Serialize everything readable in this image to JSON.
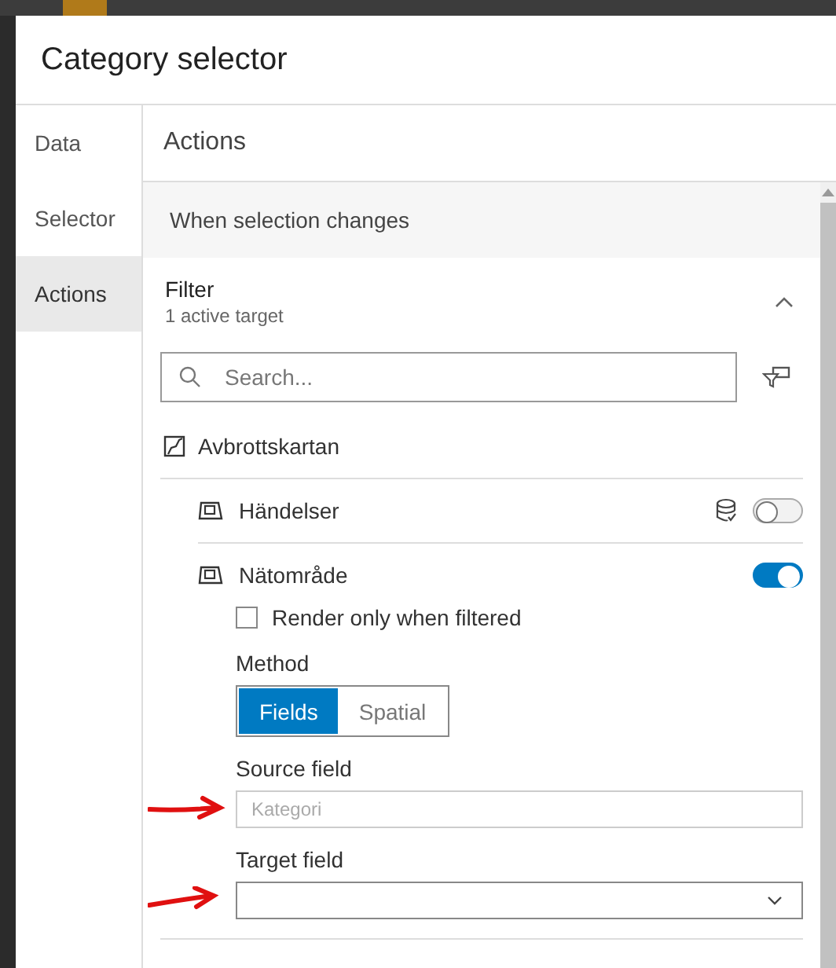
{
  "dialog": {
    "title": "Category selector"
  },
  "nav": [
    {
      "label": "Data",
      "selected": false
    },
    {
      "label": "Selector",
      "selected": false
    },
    {
      "label": "Actions",
      "selected": true
    }
  ],
  "panel": {
    "title": "Actions",
    "section": "When selection changes",
    "filter": {
      "title": "Filter",
      "subtitle": "1 active target",
      "expanded": true,
      "search": {
        "placeholder": "Search..."
      },
      "map": {
        "name": "Avbrottskartan"
      },
      "layers": [
        {
          "name": "Händelser",
          "on": false,
          "source_icon": true,
          "expanded": false
        },
        {
          "name": "Nätområde",
          "on": true,
          "source_icon": false,
          "expanded": true,
          "render_option": {
            "label": "Render only when filtered",
            "checked": false
          },
          "method": {
            "label": "Method",
            "options": [
              {
                "label": "Fields",
                "selected": true
              },
              {
                "label": "Spatial",
                "selected": false
              }
            ]
          },
          "source_field": {
            "label": "Source field",
            "placeholder": "Kategori"
          },
          "target_field": {
            "label": "Target field"
          }
        }
      ]
    }
  },
  "annotations": [
    {
      "kind": "arrow"
    },
    {
      "kind": "arrow"
    }
  ]
}
